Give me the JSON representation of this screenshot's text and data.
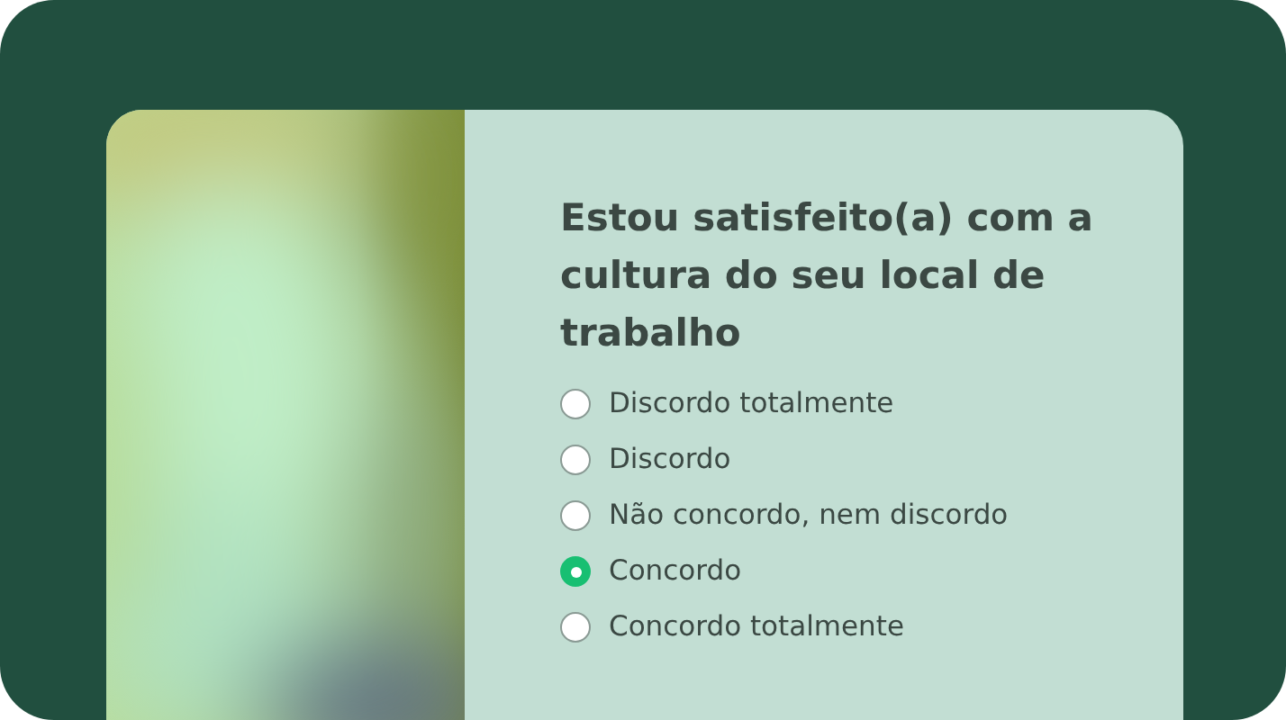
{
  "question": {
    "title": "Estou satisfeito(a) com a cultura do seu local de trabalho",
    "options": [
      {
        "label": "Discordo totalmente",
        "selected": false
      },
      {
        "label": "Discordo",
        "selected": false
      },
      {
        "label": "Não concordo, nem discordo",
        "selected": false
      },
      {
        "label": "Concordo",
        "selected": true
      },
      {
        "label": "Concordo totalmente",
        "selected": false
      }
    ]
  }
}
